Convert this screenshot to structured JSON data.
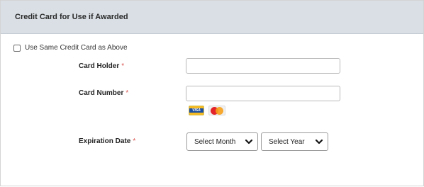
{
  "section": {
    "title": "Credit Card for Use if Awarded"
  },
  "same_card": {
    "label": "Use Same Credit Card as Above",
    "checked": false
  },
  "fields": {
    "card_holder": {
      "label": "Card Holder",
      "required_mark": "*",
      "value": ""
    },
    "card_number": {
      "label": "Card Number",
      "required_mark": "*",
      "value": ""
    },
    "expiration": {
      "label": "Expiration Date",
      "required_mark": "*"
    }
  },
  "card_logos": {
    "visa": "VISA",
    "mastercard": "MasterCard"
  },
  "selects": {
    "month": {
      "selected": "Select Month"
    },
    "year": {
      "selected": "Select Year"
    }
  },
  "colors": {
    "header_bg": "#d9dfe5",
    "required": "#d9534f"
  }
}
